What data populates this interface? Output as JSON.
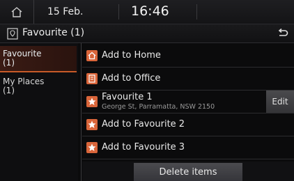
{
  "status": {
    "date": "15 Feb.",
    "time": "16:46",
    "home_icon": "home-icon"
  },
  "title_bar": {
    "title": "Favourite (1)",
    "icon": "location-pin-icon",
    "back_icon": "back-arrow-icon"
  },
  "sidebar": {
    "items": [
      {
        "label_line1": "Favourite",
        "label_line2": "(1)",
        "active": true
      },
      {
        "label_line1": "My Places",
        "label_line2": "(1)",
        "active": false
      }
    ]
  },
  "list": {
    "rows": [
      {
        "label": "Add to Home",
        "icon": "home-badge-icon"
      },
      {
        "label": "Add to Office",
        "icon": "office-badge-icon"
      },
      {
        "label": "Favourite 1",
        "subtitle": "George St, Parramatta, NSW 2150",
        "icon": "star-badge-icon",
        "edit_label": "Edit"
      },
      {
        "label": "Add to Favourite 2",
        "icon": "star-badge-icon"
      },
      {
        "label": "Add to Favourite 3",
        "icon": "star-badge-icon"
      }
    ]
  },
  "footer": {
    "delete_label": "Delete items"
  },
  "colors": {
    "accent": "#c85a28",
    "badge": "#d9653a",
    "background": "#0b0b0c"
  }
}
